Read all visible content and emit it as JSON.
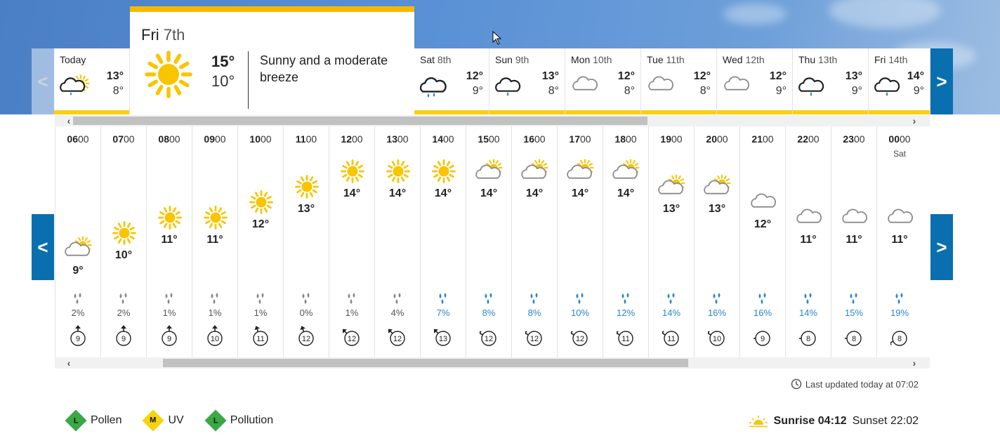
{
  "colors": {
    "accent": "#0a6faf",
    "sun": "#f9c400",
    "bar": "#f9cf12",
    "rain_blue": "#2a86c8",
    "rain_grey": "#888888"
  },
  "nav": {
    "prev_symbol": "<",
    "next_symbol": ">"
  },
  "days": [
    {
      "name": "Today",
      "date": "",
      "hi": "13°",
      "lo": "8°",
      "icon": "rain-sun-icon"
    },
    {
      "name": "Sat",
      "date": "8th",
      "hi": "12°",
      "lo": "9°",
      "icon": "heavy-rain-icon"
    },
    {
      "name": "Sun",
      "date": "9th",
      "hi": "13°",
      "lo": "8°",
      "icon": "light-rain-icon"
    },
    {
      "name": "Mon",
      "date": "10th",
      "hi": "12°",
      "lo": "8°",
      "icon": "cloud-icon"
    },
    {
      "name": "Tue",
      "date": "11th",
      "hi": "12°",
      "lo": "8°",
      "icon": "cloud-icon"
    },
    {
      "name": "Wed",
      "date": "12th",
      "hi": "12°",
      "lo": "9°",
      "icon": "cloud-icon"
    },
    {
      "name": "Thu",
      "date": "13th",
      "hi": "13°",
      "lo": "9°",
      "icon": "light-rain-icon"
    },
    {
      "name": "Fri",
      "date": "14th",
      "hi": "14°",
      "lo": "9°",
      "icon": "light-rain-icon"
    }
  ],
  "selected_day": {
    "name": "Fri",
    "date": "7th",
    "hi": "15°",
    "lo": "10°",
    "description": "Sunny and a moderate breeze",
    "icon": "sun-icon"
  },
  "hours": [
    {
      "hh": "06",
      "mm": "00",
      "sub": "",
      "temp": "9°",
      "icon": "sun-cloud-icon",
      "rain": "2%",
      "rain_level": "low",
      "wind": "9",
      "wind_dir": 0
    },
    {
      "hh": "07",
      "mm": "00",
      "sub": "",
      "temp": "10°",
      "icon": "sun-icon",
      "rain": "2%",
      "rain_level": "low",
      "wind": "9",
      "wind_dir": 0
    },
    {
      "hh": "08",
      "mm": "00",
      "sub": "",
      "temp": "11°",
      "icon": "sun-icon",
      "rain": "1%",
      "rain_level": "low",
      "wind": "9",
      "wind_dir": 0
    },
    {
      "hh": "09",
      "mm": "00",
      "sub": "",
      "temp": "11°",
      "icon": "sun-icon",
      "rain": "1%",
      "rain_level": "low",
      "wind": "10",
      "wind_dir": 0
    },
    {
      "hh": "10",
      "mm": "00",
      "sub": "",
      "temp": "12°",
      "icon": "sun-icon",
      "rain": "1%",
      "rain_level": "low",
      "wind": "11",
      "wind_dir": -20
    },
    {
      "hh": "11",
      "mm": "00",
      "sub": "",
      "temp": "13°",
      "icon": "sun-icon",
      "rain": "0%",
      "rain_level": "low",
      "wind": "12",
      "wind_dir": -20
    },
    {
      "hh": "12",
      "mm": "00",
      "sub": "",
      "temp": "14°",
      "icon": "sun-icon",
      "rain": "1%",
      "rain_level": "low",
      "wind": "12",
      "wind_dir": -45
    },
    {
      "hh": "13",
      "mm": "00",
      "sub": "",
      "temp": "14°",
      "icon": "sun-icon",
      "rain": "4%",
      "rain_level": "low",
      "wind": "12",
      "wind_dir": -45
    },
    {
      "hh": "14",
      "mm": "00",
      "sub": "",
      "temp": "14°",
      "icon": "sun-icon",
      "rain": "7%",
      "rain_level": "high",
      "wind": "13",
      "wind_dir": -45
    },
    {
      "hh": "15",
      "mm": "00",
      "sub": "",
      "temp": "14°",
      "icon": "sun-cloud-icon",
      "rain": "8%",
      "rain_level": "high",
      "wind": "12",
      "wind_dir": -60
    },
    {
      "hh": "16",
      "mm": "00",
      "sub": "",
      "temp": "14°",
      "icon": "sun-cloud-icon",
      "rain": "8%",
      "rain_level": "high",
      "wind": "12",
      "wind_dir": -60
    },
    {
      "hh": "17",
      "mm": "00",
      "sub": "",
      "temp": "14°",
      "icon": "sun-cloud-icon",
      "rain": "10%",
      "rain_level": "high",
      "wind": "12",
      "wind_dir": -60
    },
    {
      "hh": "18",
      "mm": "00",
      "sub": "",
      "temp": "14°",
      "icon": "sun-cloud-icon",
      "rain": "12%",
      "rain_level": "high",
      "wind": "11",
      "wind_dir": -60
    },
    {
      "hh": "19",
      "mm": "00",
      "sub": "",
      "temp": "13°",
      "icon": "sun-cloud-icon",
      "rain": "14%",
      "rain_level": "high",
      "wind": "11",
      "wind_dir": -60
    },
    {
      "hh": "20",
      "mm": "00",
      "sub": "",
      "temp": "13°",
      "icon": "sun-cloud-icon",
      "rain": "16%",
      "rain_level": "high",
      "wind": "10",
      "wind_dir": -60
    },
    {
      "hh": "21",
      "mm": "00",
      "sub": "",
      "temp": "12°",
      "icon": "cloud-icon",
      "rain": "16%",
      "rain_level": "high",
      "wind": "9",
      "wind_dir": -90
    },
    {
      "hh": "22",
      "mm": "00",
      "sub": "",
      "temp": "11°",
      "icon": "cloud-icon",
      "rain": "14%",
      "rain_level": "high",
      "wind": "8",
      "wind_dir": -90
    },
    {
      "hh": "23",
      "mm": "00",
      "sub": "",
      "temp": "11°",
      "icon": "cloud-icon",
      "rain": "15%",
      "rain_level": "high",
      "wind": "8",
      "wind_dir": -90
    },
    {
      "hh": "00",
      "mm": "00",
      "sub": "Sat",
      "temp": "11°",
      "icon": "cloud-icon",
      "rain": "19%",
      "rain_level": "high",
      "wind": "8",
      "wind_dir": -115
    }
  ],
  "footer": {
    "last_updated": "Last updated today at 07:02",
    "pollen": {
      "label": "Pollen",
      "level": "L",
      "color": "#3aa845"
    },
    "uv": {
      "label": "UV",
      "level": "M",
      "color": "#f6d40c"
    },
    "pollution": {
      "label": "Pollution",
      "level": "L",
      "color": "#3aa845"
    },
    "sunrise_label": "Sunrise",
    "sunrise_time": "04:12",
    "sunset_label": "Sunset",
    "sunset_time": "22:02"
  }
}
